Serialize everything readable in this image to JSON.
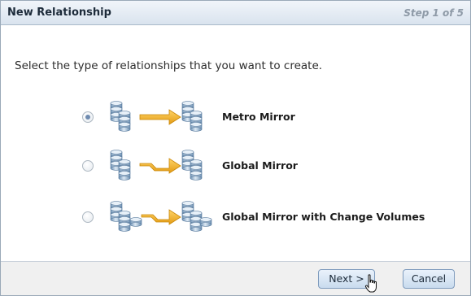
{
  "dialog": {
    "title": "New Relationship",
    "step": "Step 1 of 5",
    "instruction": "Select the type of relationships that you want to create."
  },
  "options": [
    {
      "label": "Metro Mirror",
      "selected": true,
      "icon": "metro-mirror-icon"
    },
    {
      "label": "Global Mirror",
      "selected": false,
      "icon": "global-mirror-icon"
    },
    {
      "label": "Global Mirror with Change Volumes",
      "selected": false,
      "icon": "global-mirror-change-volumes-icon"
    }
  ],
  "buttons": {
    "next": "Next >",
    "cancel": "Cancel"
  },
  "colors": {
    "arrow": "#f0a81f",
    "disk": "#7fa2c4",
    "disk_light": "#d9e6f2"
  }
}
